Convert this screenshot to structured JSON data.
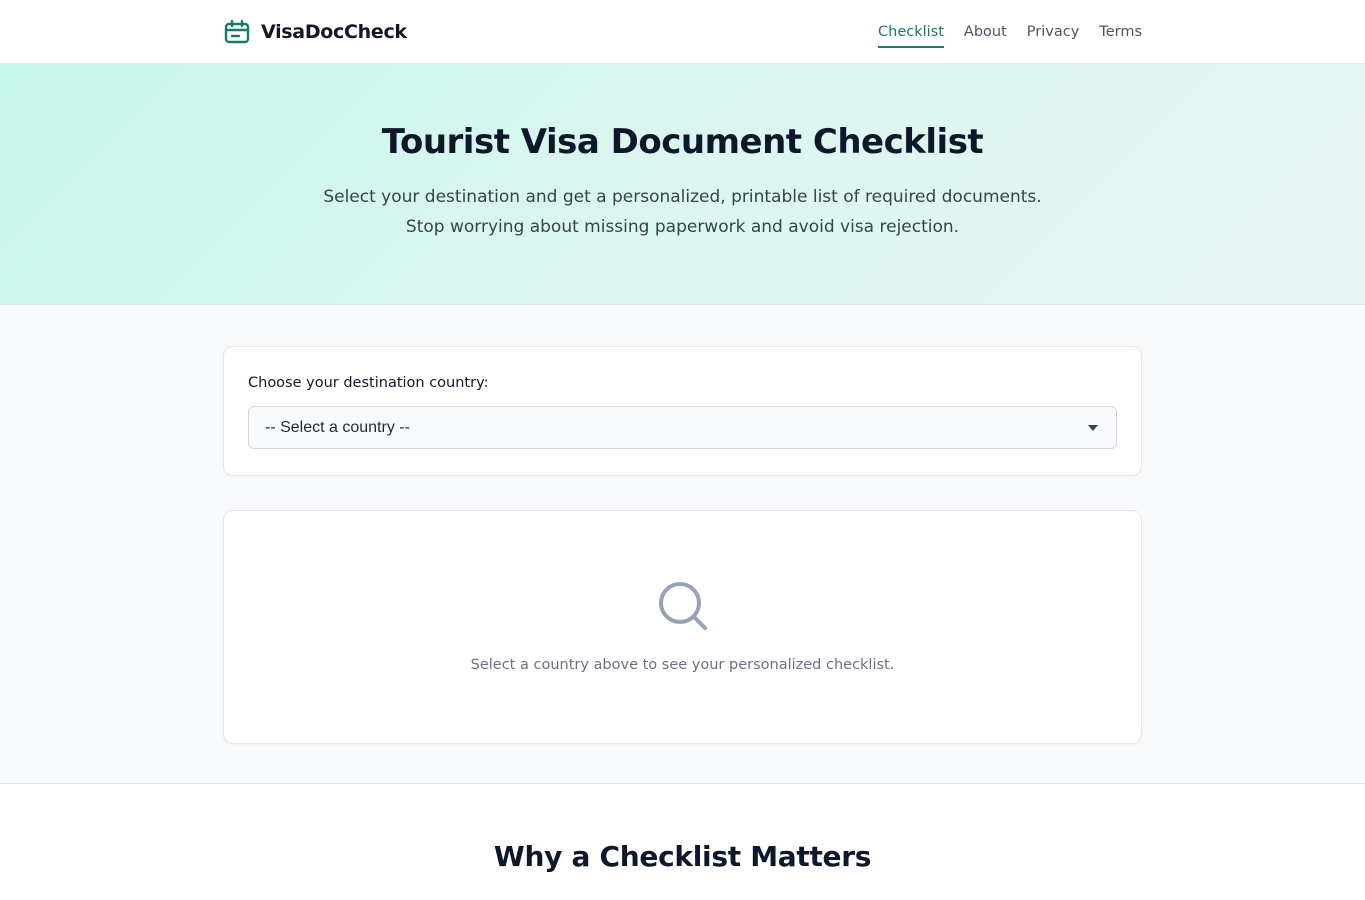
{
  "header": {
    "brand": "VisaDocCheck",
    "brand_icon": "calendar-card-icon",
    "accent_color": "#1a7a68",
    "nav": [
      {
        "label": "Checklist",
        "active": true
      },
      {
        "label": "About",
        "active": false
      },
      {
        "label": "Privacy",
        "active": false
      },
      {
        "label": "Terms",
        "active": false
      }
    ]
  },
  "hero": {
    "title": "Tourist Visa Document Checklist",
    "subtitle_line1": "Select your destination and get a personalized, printable list of required documents.",
    "subtitle_line2": "Stop worrying about missing paperwork and avoid visa rejection."
  },
  "country_select": {
    "label": "Choose your destination country:",
    "selected_value": "-- Select a country --",
    "icon": "chevron-down-icon"
  },
  "results": {
    "icon": "search-icon",
    "empty_message": "Select a country above to see your personalized checklist."
  },
  "why_section": {
    "title": "Why a Checklist Matters"
  }
}
